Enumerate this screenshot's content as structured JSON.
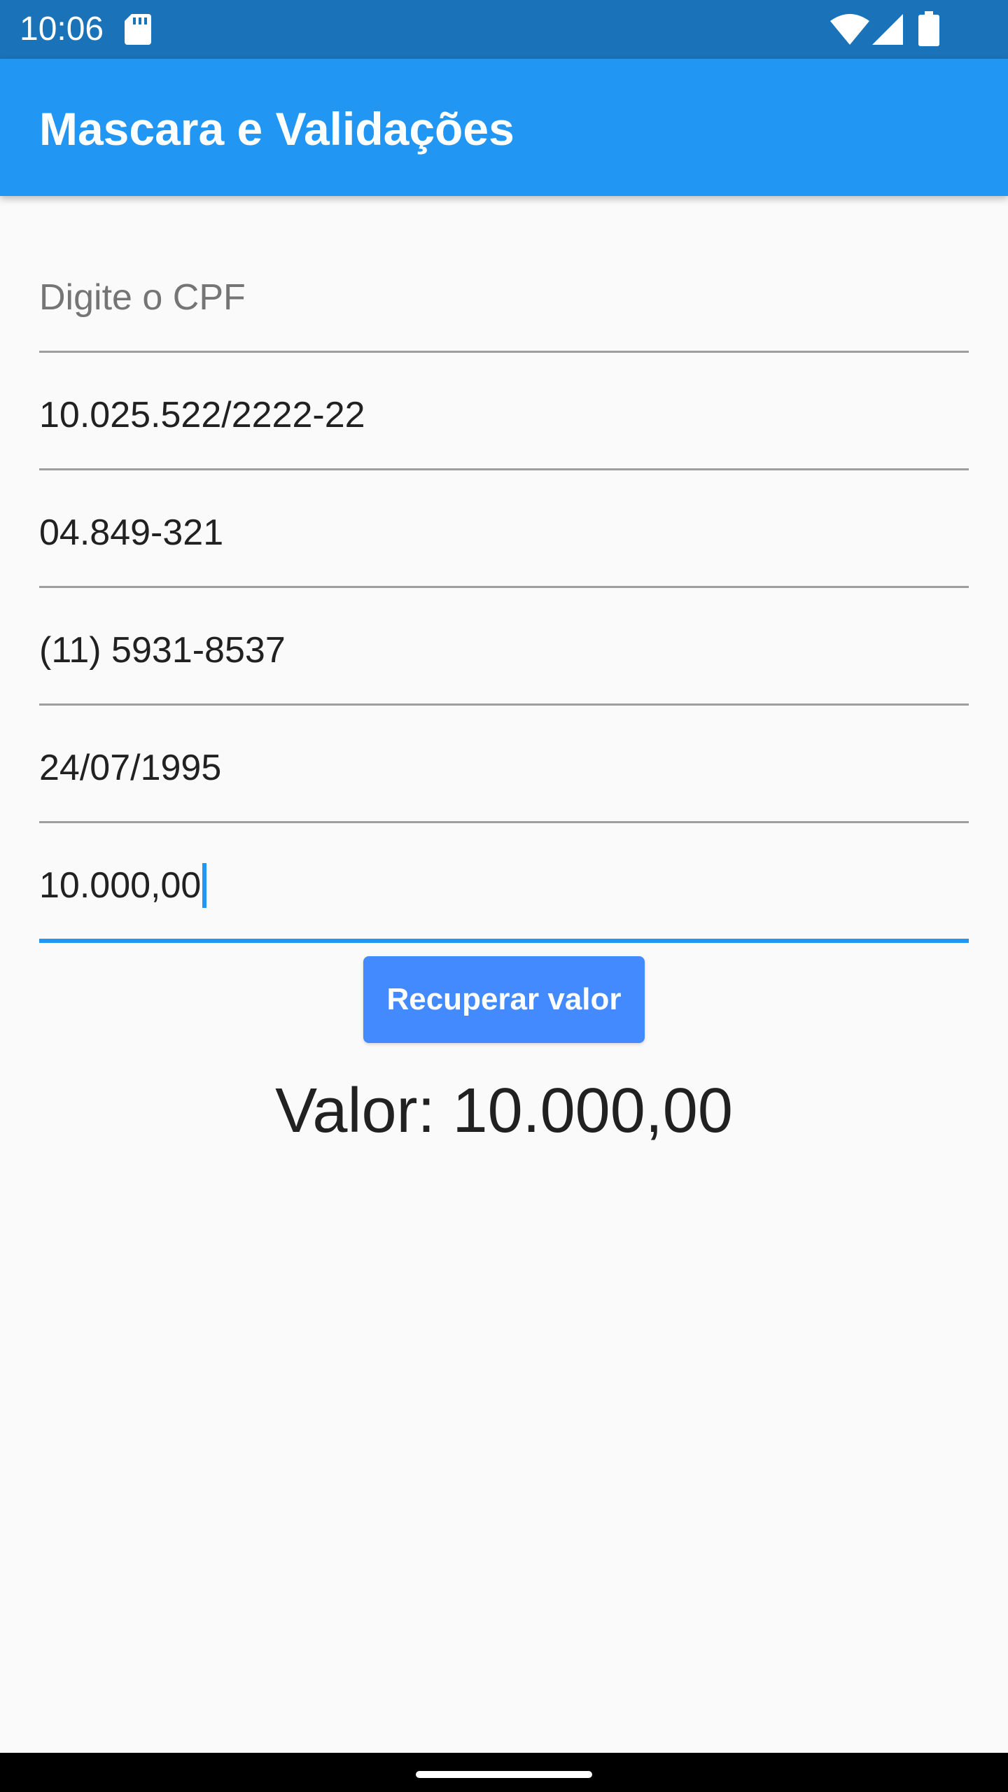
{
  "status_bar": {
    "time": "10:06",
    "icons": [
      "sd-card-icon",
      "wifi-icon",
      "signal-icon",
      "battery-icon"
    ]
  },
  "app_bar": {
    "title": "Mascara e Validações",
    "color": "#2196f3"
  },
  "form": {
    "cpf": {
      "placeholder": "Digite o CPF",
      "value": ""
    },
    "cnpj": {
      "value": "10.025.522/2222-22"
    },
    "cep": {
      "value": "04.849-321"
    },
    "telefone": {
      "value": "(11) 5931-8537"
    },
    "data": {
      "value": "24/07/1995"
    },
    "valor": {
      "value": "10.000,00",
      "focused": true
    }
  },
  "button": {
    "label": "Recuperar valor",
    "color": "#448aff"
  },
  "result": {
    "text": "Valor: 10.000,00"
  }
}
